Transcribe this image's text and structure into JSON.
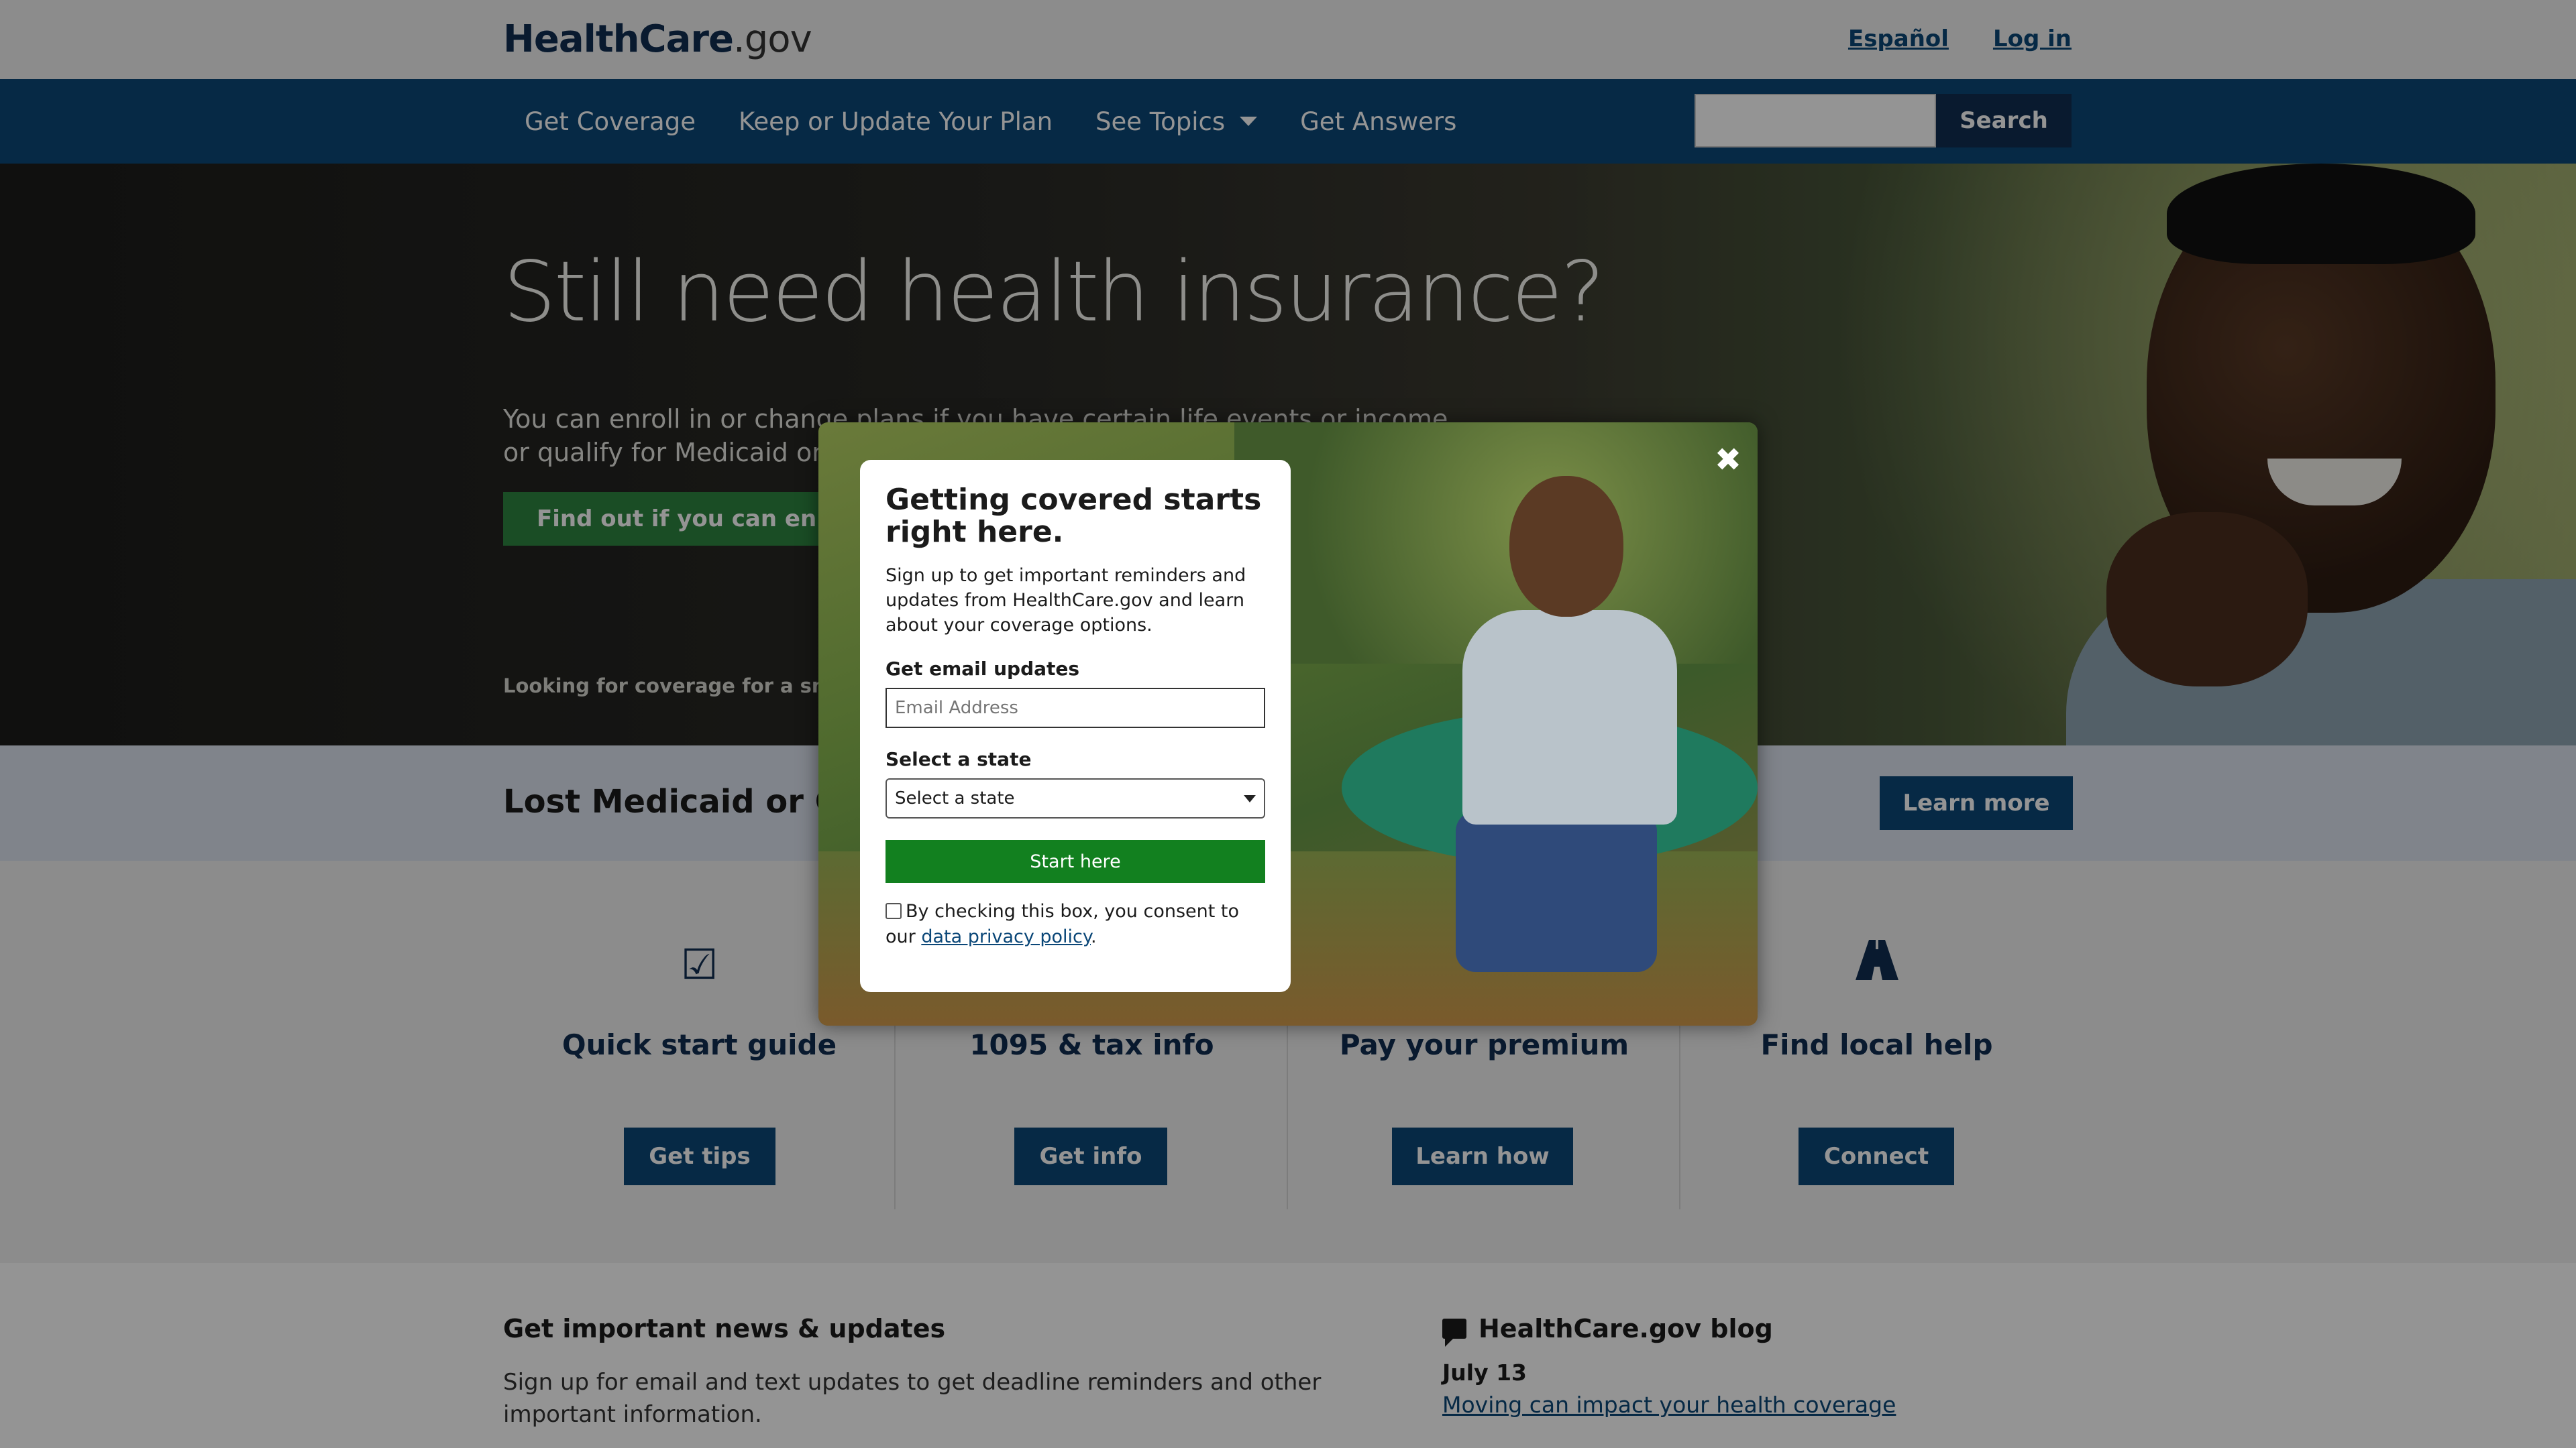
{
  "header": {
    "logo_main": "HealthCare",
    "logo_suffix": ".gov",
    "links": [
      "Español",
      "Log in"
    ]
  },
  "nav": {
    "items": [
      "Get Coverage",
      "Keep or Update Your Plan",
      "See Topics",
      "Get Answers"
    ],
    "search_button": "Search",
    "search_value": ""
  },
  "hero": {
    "title": "Still need health insurance?",
    "subtitle": "You can enroll in or change plans if you have certain life events or income, or qualify for Medicaid or CHIP.",
    "button": "Find out if you can enroll/",
    "small_text": "Looking for coverage for a small b"
  },
  "banner": {
    "title": "Lost Medicaid or CHI",
    "button": "Learn more"
  },
  "cards": [
    {
      "icon": "checkbox-icon",
      "title": "Quick start guide",
      "button": "Get tips"
    },
    {
      "icon": "tax-form-icon",
      "title": "1095 & tax info",
      "button": "Get info"
    },
    {
      "icon": "credit-card-icon",
      "title": "Pay your premium",
      "button": "Learn how"
    },
    {
      "icon": "road-icon",
      "title": "Find local help",
      "button": "Connect"
    }
  ],
  "news": {
    "title": "Get important news & updates",
    "text": "Sign up for email and text updates to get deadline reminders and other important information."
  },
  "blog": {
    "title": "HealthCare.gov blog",
    "date": "July 13",
    "link": "Moving can impact your health coverage"
  },
  "modal": {
    "close_label": "✖",
    "title": "Getting covered starts right here.",
    "description": "Sign up to get important reminders and updates from HealthCare.gov and learn about your coverage options.",
    "email_label": "Get email updates",
    "email_placeholder": "Email Address",
    "state_label": "Select a state",
    "state_selected": "Select a state",
    "start_button": "Start here",
    "consent_text": "By checking this box, you consent to our",
    "consent_link": "data privacy policy",
    "consent_end": "."
  },
  "colors": {
    "primary": "#0b4778",
    "dark": "#112e51",
    "green": "#2e8540",
    "modal_green": "#12801f"
  }
}
